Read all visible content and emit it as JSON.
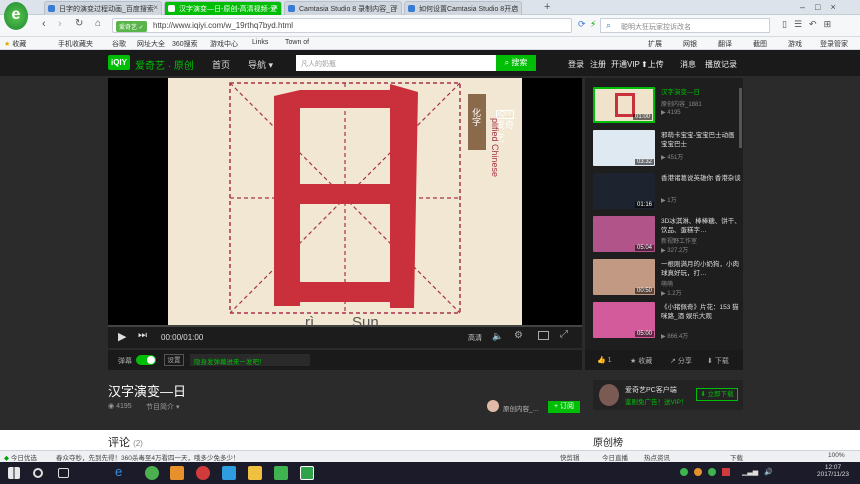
{
  "browser": {
    "tabs": [
      {
        "label": "日字的演变过程动画_百度搜索",
        "color": "#3a7bd5"
      },
      {
        "label": "汉字演变—日-原创-高清视频-爱",
        "color": "#00be06"
      },
      {
        "label": "Camtasia Studio 8 录制内容_百",
        "color": "#3a7bd5"
      },
      {
        "label": "如何设置Camtasia Studio 8开启",
        "color": "#3a7bd5"
      }
    ],
    "new_tab": "+",
    "site_badge": "爱奇艺 ✓",
    "url": "http://www.iqiyi.com/w_19rthq7byd.html",
    "search_placeholder": "聪明大狂玩家控诉改名",
    "bookmarks": [
      "收藏",
      "手机收藏夹",
      "谷歌",
      "网址大全",
      "360搜索",
      "游戏中心",
      "Links",
      "Town of"
    ],
    "bookmark_tools": [
      "扩展",
      "网银",
      "翻译",
      "截图",
      "游戏",
      "登录管家"
    ]
  },
  "site": {
    "logo": "iQIY",
    "brand": "爱奇艺 · 原创",
    "nav": [
      "首页",
      "导航"
    ],
    "search_placeholder": "凡人的奶瓶",
    "search_button": "搜索",
    "user_links": [
      "登录",
      "注册",
      "开通VIP",
      "上传",
      "消息",
      "播放记录"
    ]
  },
  "player": {
    "watermark": "爱奇艺",
    "side_text_1": "化字",
    "side_text_2": "plified Chinese",
    "character": "日",
    "pinyin": "rì",
    "sun": "Sun",
    "time": "00:00/01:00",
    "quality": "高清",
    "barrage_label": "弹幕",
    "settings_label": "设置",
    "barrage_hint": "隐身发弹幕进来一发吧！",
    "side_icon_label": "分享"
  },
  "sidebar": {
    "items": [
      {
        "title": "汉字演变—日",
        "sub": "原创内容_1881",
        "meta": "4195",
        "duration": "01:00",
        "active": true,
        "color": "#f0e3cc"
      },
      {
        "title": "邪萌卡宝宝-宝宝巴士动画 宝宝巴士",
        "sub": "",
        "meta": "451万",
        "duration": "03:32",
        "active": false,
        "color": "#dfe9f1"
      },
      {
        "title": "香港诸葛说英雄你 香港杂谈",
        "sub": "",
        "meta": "1万",
        "duration": "01:16",
        "active": false,
        "color": "#1d2430"
      },
      {
        "title": "3D冰淇淋、棒棒糖、饼干、饮品、蛋糕字…",
        "sub": "新视野工作室",
        "meta": "327.2万",
        "duration": "05:04",
        "active": false,
        "color": "#b0548a"
      },
      {
        "title": "一根刚满月的小奶狗，小肉球真好玩，打…",
        "sub": "萌萌",
        "meta": "1.2万",
        "duration": "00:50",
        "active": false,
        "color": "#c29a84"
      },
      {
        "title": "《小猪佩奇》片花：153 猫咪路_酒 娱乐大观",
        "sub": "",
        "meta": "866.4万",
        "duration": "05:00",
        "active": false,
        "color": "#d35b9b"
      }
    ],
    "actions": [
      "1",
      "收藏",
      "分享",
      "下载"
    ]
  },
  "video_info": {
    "title": "汉字演变—日",
    "plays": "4195",
    "category": "节目简介",
    "uploader": "原创内容_…",
    "subscribe": "+ 订阅",
    "promo_title": "爱奇艺PC客户端",
    "promo_sub": "鉴剧免广告！送VIP！",
    "promo_button": "立即下载"
  },
  "comments": {
    "label": "评论",
    "count": "(2)",
    "right_label": "原创榜"
  },
  "statusbar": {
    "left": "今日优选",
    "news": "春众夺秒，先到先得！360杀毒至4万看四一天，哦多少免多少！",
    "right": [
      "快剪辑",
      "今日直播",
      "热点资讯",
      "下载",
      "100%"
    ]
  },
  "taskbar": {
    "time": "12:07",
    "date": "2017/11/23"
  }
}
